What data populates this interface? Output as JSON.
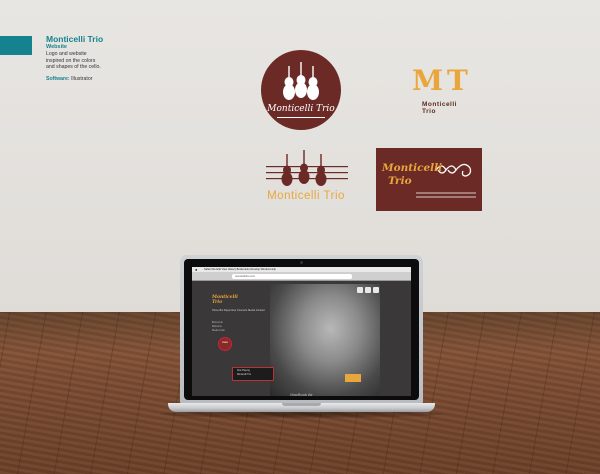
{
  "caption": {
    "title": "Monticelli Trio",
    "subtitle": "Website",
    "description_lines": [
      "Logo and website",
      "inspired on the colors",
      "and shapes of the cello."
    ],
    "software_label": "Software:",
    "software_value": "Illustrator"
  },
  "logos": {
    "circle_text": "Monticelli Trio",
    "mt_letters": "MT",
    "mt_sub": "Monticelli Trio",
    "strings_text": "Monticelli Trio",
    "rect_line1": "Monticelli",
    "rect_line2": "Trio"
  },
  "laptop": {
    "brand": "MacBook Air",
    "menubar": "Safari   File   Edit   View   History   Bookmarks   Develop   Window   Help",
    "url": "monticellitrio.com",
    "site_logo": "Monticelli Trio",
    "site_nav": "Home  Bio  Repertoire  Concerts  Media  Contact",
    "side_lines": [
      "Benvenuti",
      "Welcome",
      "Media Links"
    ],
    "player_lines": [
      "Now Playing",
      "Monticelli Trio"
    ],
    "red_dot_label": "Listen"
  },
  "colors": {
    "brand_burgundy": "#6b2a26",
    "brand_orange": "#e8a63c",
    "accent_teal": "#17828f"
  }
}
